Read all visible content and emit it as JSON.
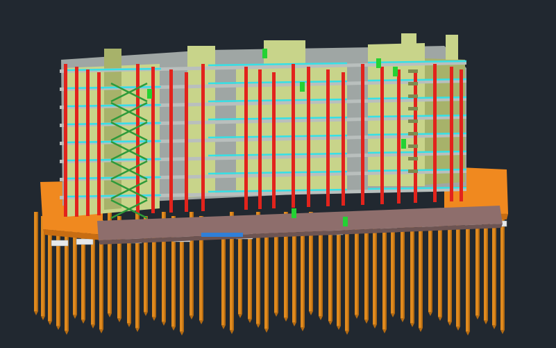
{
  "scene": {
    "description_type": "3d-structural-bim-model",
    "background": "#212830",
    "colors": {
      "pile": "#e08a1e",
      "pile_shadow": "#b36a12",
      "slab": "#b9bfbd",
      "slab_edge": "#8f9593",
      "wall": "#c8d48a",
      "wall_dark": "#a7b26a",
      "column": "#e2231c",
      "beam": "#36e0e6",
      "brace": "#2e9a3a",
      "highlight": "#24d233",
      "podium": "#f0891f",
      "podium_dark": "#c86d12",
      "basement": "#8e6e6c",
      "cap": "#e6e8ea",
      "blue_strip": "#2f7fd8"
    }
  }
}
